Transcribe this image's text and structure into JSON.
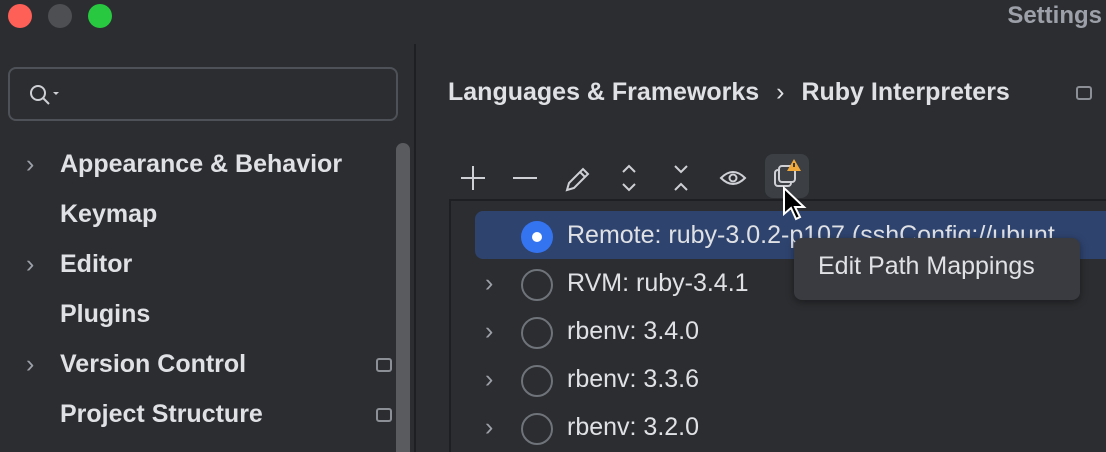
{
  "window": {
    "title": "Settings"
  },
  "search": {
    "placeholder": ""
  },
  "sidebar": {
    "items": [
      {
        "label": "Appearance & Behavior",
        "expandable": true,
        "pinned": false
      },
      {
        "label": "Keymap",
        "expandable": false,
        "pinned": false
      },
      {
        "label": "Editor",
        "expandable": true,
        "pinned": false
      },
      {
        "label": "Plugins",
        "expandable": false,
        "pinned": false
      },
      {
        "label": "Version Control",
        "expandable": true,
        "pinned": true
      },
      {
        "label": "Project Structure",
        "expandable": false,
        "pinned": true
      }
    ]
  },
  "breadcrumb": {
    "parent": "Languages & Frameworks",
    "separator": "›",
    "current": "Ruby Interpreters"
  },
  "toolbar": {
    "icons": [
      "plus-icon",
      "minus-icon",
      "pencil-icon",
      "expand-icon",
      "collapse-icon",
      "eye-icon",
      "path-mappings-warning-icon"
    ]
  },
  "interpreters": [
    {
      "label": "Remote: ruby-3.0.2-p107 (sshConfig://ubunt",
      "selected": true
    },
    {
      "label": "RVM: ruby-3.4.1",
      "selected": false
    },
    {
      "label": "rbenv: 3.4.0",
      "selected": false
    },
    {
      "label": "rbenv: 3.3.6",
      "selected": false
    },
    {
      "label": "rbenv: 3.2.0",
      "selected": false
    }
  ],
  "tooltip": {
    "text": "Edit Path Mappings"
  },
  "colors": {
    "accent": "#3574f0",
    "selection": "#2e436e",
    "warning": "#f2a93b"
  }
}
